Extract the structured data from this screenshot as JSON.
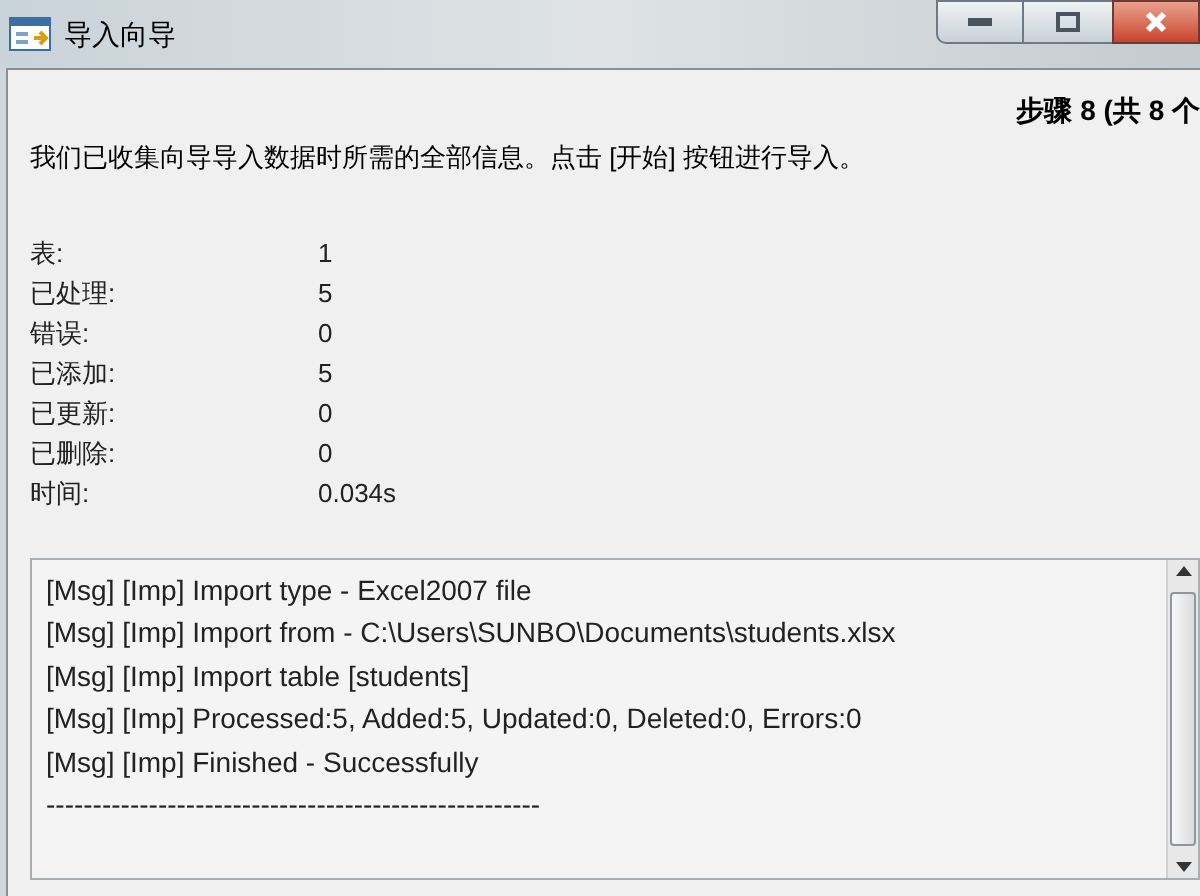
{
  "window": {
    "title": "导入向导"
  },
  "step": "步骤 8 (共 8 个",
  "description": "我们已收集向导导入数据时所需的全部信息。点击 [开始] 按钮进行导入。",
  "stats": [
    {
      "label": "表:",
      "value": "1"
    },
    {
      "label": "已处理:",
      "value": "5"
    },
    {
      "label": "错误:",
      "value": "0"
    },
    {
      "label": "已添加:",
      "value": "5"
    },
    {
      "label": "已更新:",
      "value": "0"
    },
    {
      "label": "已删除:",
      "value": "0"
    },
    {
      "label": "时间:",
      "value": "0.034s"
    }
  ],
  "log": [
    "[Msg] [Imp] Import type - Excel2007 file",
    "[Msg] [Imp] Import from - C:\\Users\\SUNBO\\Documents\\students.xlsx",
    "[Msg] [Imp] Import table [students]",
    "[Msg] [Imp] Processed:5, Added:5, Updated:0, Deleted:0, Errors:0",
    "[Msg] [Imp] Finished - Successfully",
    "-----------------------------------------------------"
  ]
}
